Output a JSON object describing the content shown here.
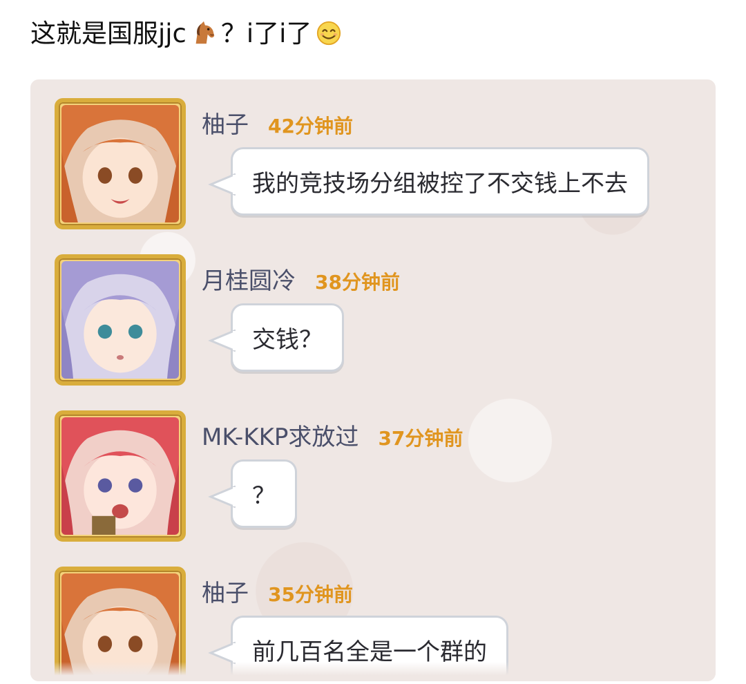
{
  "post": {
    "caption_prefix": "这就是国服jjc",
    "caption_mid": "？i了i了",
    "icons": [
      "horse-icon",
      "smile-icon"
    ]
  },
  "chat": {
    "messages": [
      {
        "user": "柚子",
        "time": "42分钟前",
        "text": "我的竞技场分组被控了不交钱上不去",
        "avatar": "orange-hair-avatar"
      },
      {
        "user": "月桂圆冷",
        "time": "38分钟前",
        "text": "交钱？",
        "avatar": "lavender-hair-avatar"
      },
      {
        "user": "MK-KKP求放过",
        "time": "37分钟前",
        "text": "？",
        "avatar": "red-hair-avatar"
      },
      {
        "user": "柚子",
        "time": "35分钟前",
        "text": "前几百名全是一个群的",
        "avatar": "orange-hair-avatar"
      }
    ]
  },
  "colors": {
    "timestamp": "#e0951f",
    "username": "#4a4f6a",
    "avatar_frame": "#d9ad3c",
    "chat_background": "#efe7e4"
  }
}
